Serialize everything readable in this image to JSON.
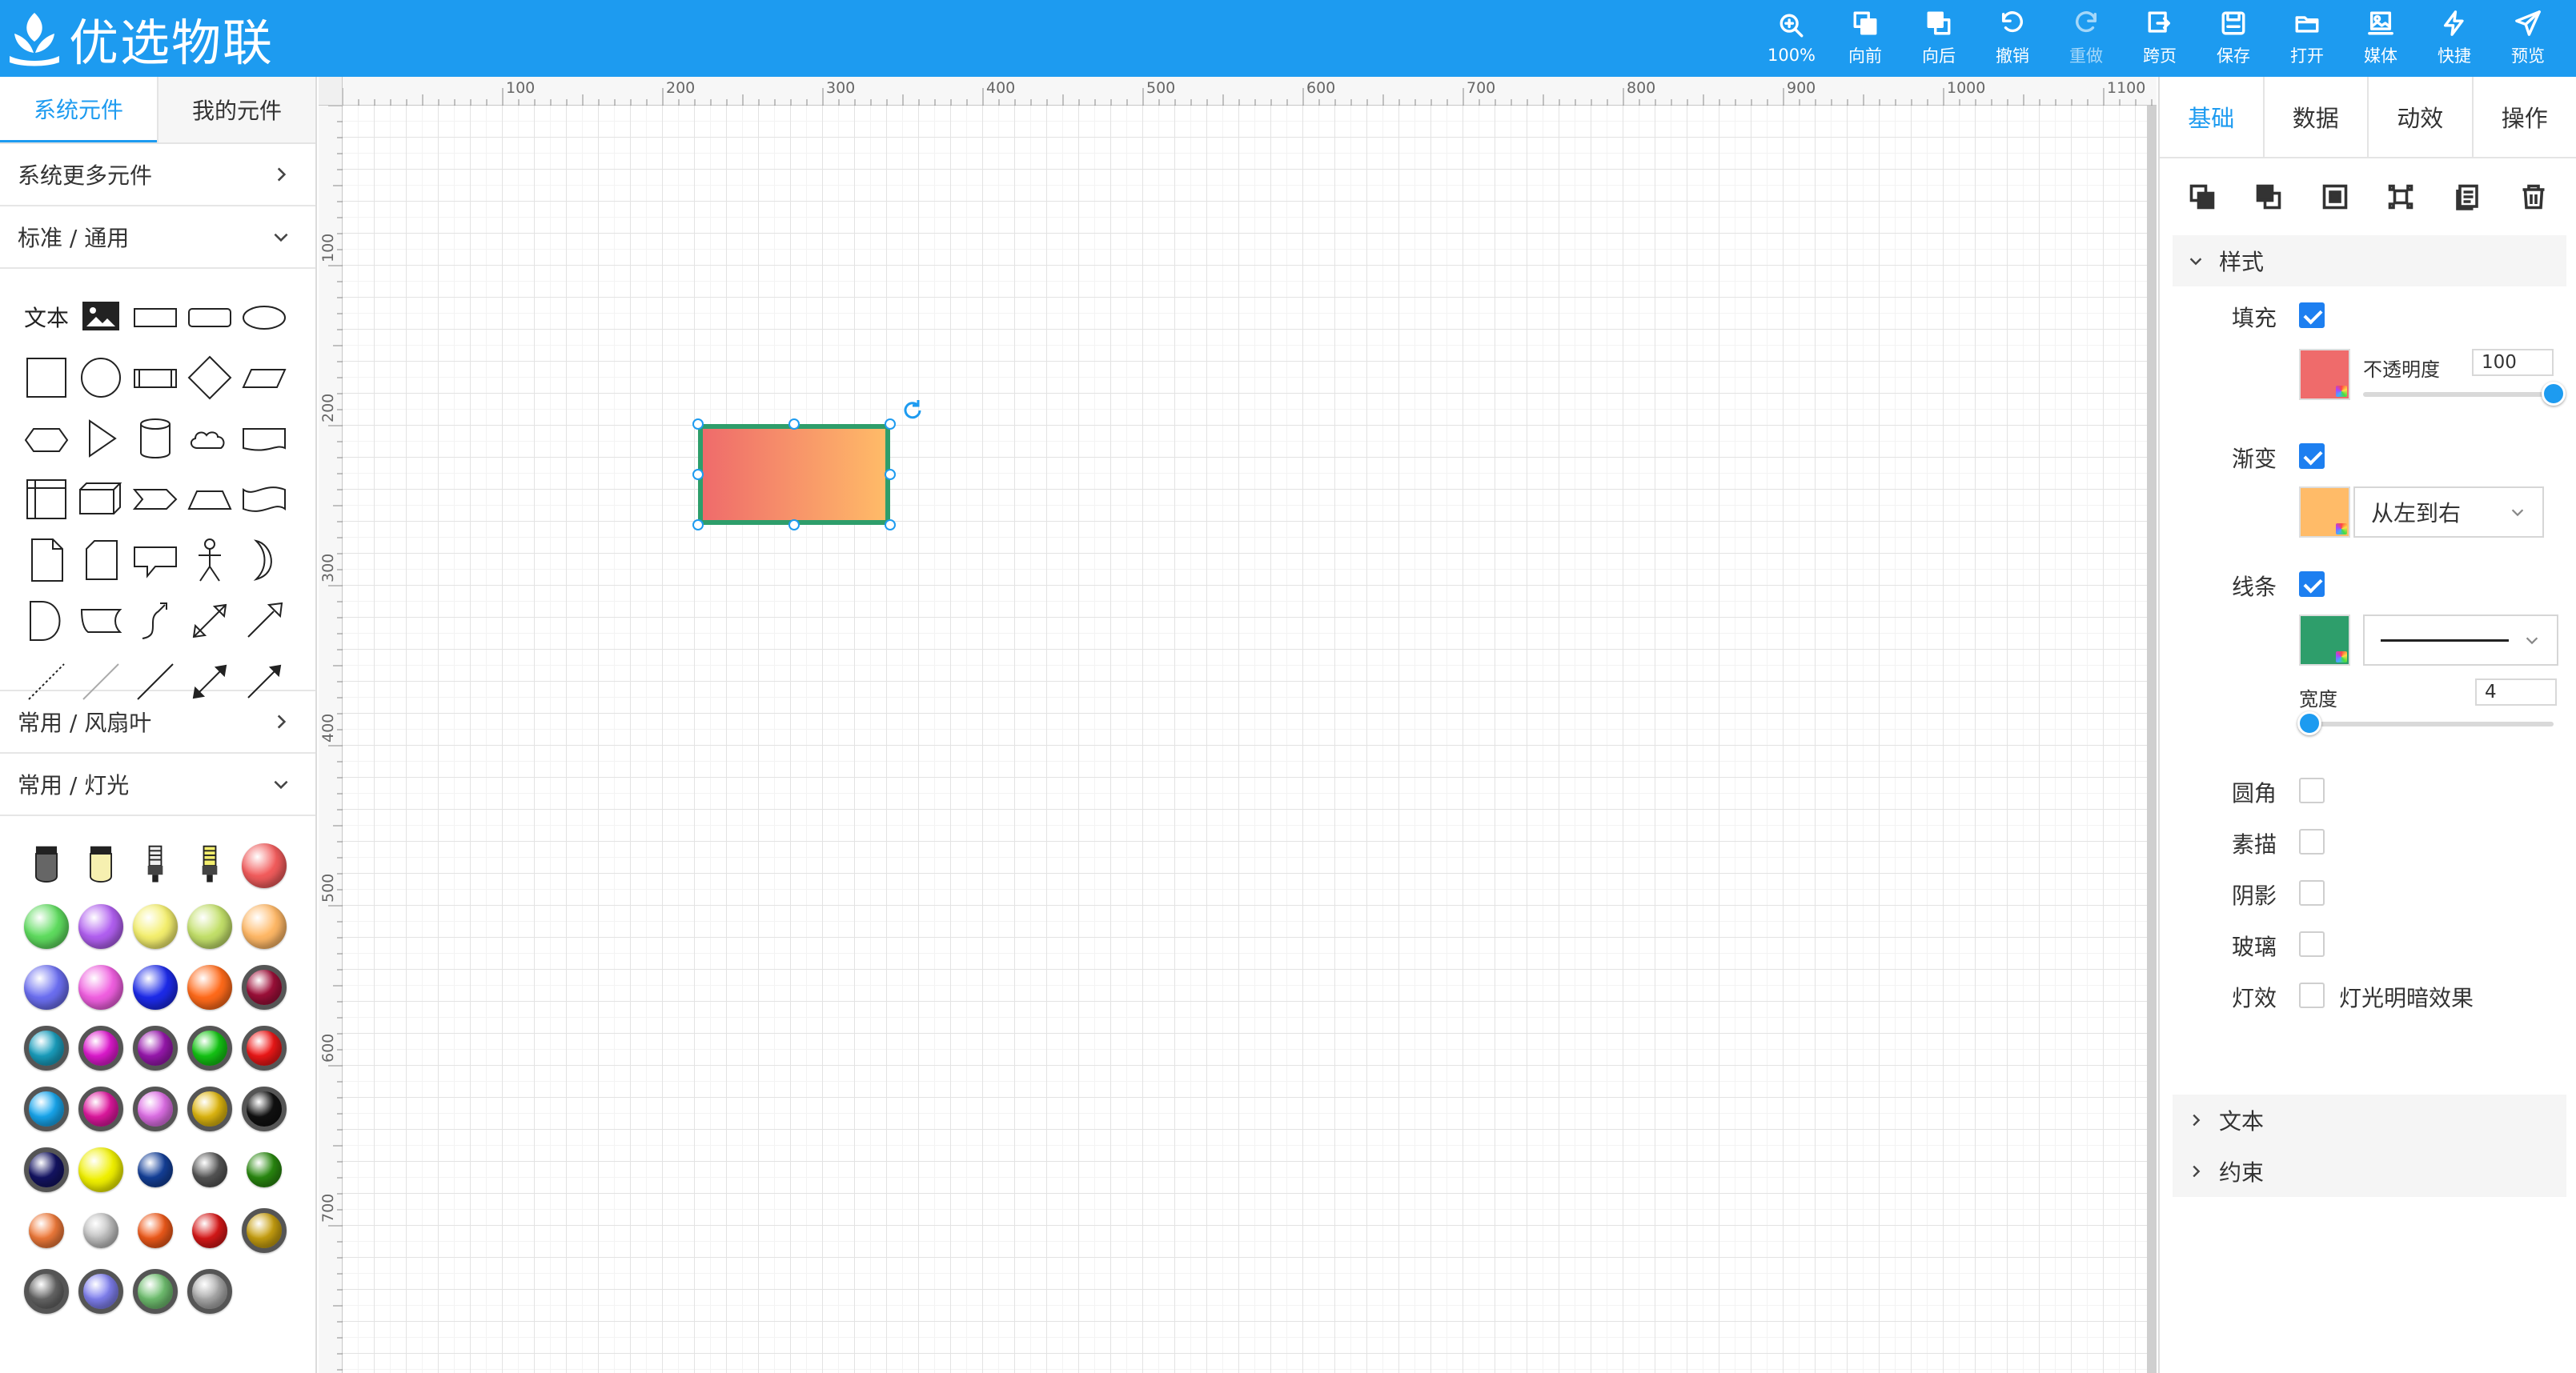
{
  "app": {
    "brand": "优选物联"
  },
  "toolbar": {
    "zoom": "100%",
    "forward": "向前",
    "backward": "向后",
    "undo": "撤销",
    "redo": "重做",
    "cross_page": "跨页",
    "save": "保存",
    "open": "打开",
    "media": "媒体",
    "quick": "快捷",
    "preview": "预览"
  },
  "left": {
    "tabs": [
      "系统元件",
      "我的元件"
    ],
    "more": "系统更多元件",
    "sections": [
      "标准 / 通用",
      "常用 / 风扇叶",
      "常用 / 灯光"
    ],
    "text_shape": "文本",
    "shape_icons": [
      "text",
      "image",
      "rectangle",
      "rounded-rectangle",
      "ellipse",
      "square",
      "circle",
      "process",
      "diamond",
      "parallelogram",
      "hexagon",
      "triangle",
      "cylinder",
      "cloud",
      "document",
      "internal-storage",
      "cube",
      "step",
      "trapezoid",
      "tape",
      "note",
      "card",
      "callout",
      "actor",
      "crescent",
      "delay",
      "loop-limit",
      "curve",
      "bidirectional-arrow",
      "arrow",
      "dashed-line",
      "thin-line",
      "line",
      "double-arrow-line",
      "arrow-line"
    ],
    "light_colors": [
      "#f25c5c",
      "#5fdc5f",
      "#b15ff0",
      "#f4ef6e",
      "#c3e06a",
      "#ffb866",
      "#6b6ef0",
      "#f05fe0",
      "#1c2ae8",
      "#ff6a1a",
      "#a0103a",
      "#1aa0c0",
      "#e01ad0",
      "#9a18b0",
      "#14c814",
      "#f01818",
      "#18a8f0",
      "#e018a0",
      "#e070e8",
      "#e0b810",
      "#111111",
      "#141464",
      "#f0f000",
      "#14409a",
      "#555555",
      "#2a8a10",
      "#f07a3a",
      "#c0c0c0",
      "#f05a1a",
      "#d81818",
      "#c8a010",
      "#666666",
      "#8080f0",
      "#70c070",
      "#aaaaaa"
    ]
  },
  "ruler": {
    "top_labels": [
      "100",
      "200",
      "300",
      "400",
      "500",
      "600",
      "700",
      "800",
      "900",
      "1000",
      "1100"
    ],
    "left_labels": [
      "100",
      "200",
      "300",
      "400",
      "500",
      "600",
      "700"
    ]
  },
  "right": {
    "tabs": [
      "基础",
      "数据",
      "动效",
      "操作"
    ],
    "action_icons": [
      "bring-forward-icon",
      "send-backward-icon",
      "group-icon",
      "ungroup-icon",
      "copy-icon",
      "delete-icon"
    ],
    "style_section": "样式",
    "fill": {
      "label": "填充",
      "checked": true,
      "color": "#ef6b6b",
      "opacity_label": "不透明度",
      "opacity": "100",
      "opacity_level": 1.0
    },
    "gradient": {
      "label": "渐变",
      "checked": true,
      "color": "#ffbb68",
      "direction": "从左到右"
    },
    "stroke": {
      "label": "线条",
      "checked": true,
      "color": "#2e9e6b",
      "width_label": "宽度",
      "width": "4",
      "width_level": 0.04
    },
    "options": [
      {
        "label": "圆角",
        "checked": false
      },
      {
        "label": "素描",
        "checked": false
      },
      {
        "label": "阴影",
        "checked": false
      },
      {
        "label": "玻璃",
        "checked": false
      },
      {
        "label": "灯效",
        "checked": false,
        "note": "灯光明暗效果"
      }
    ],
    "text_section": "文本",
    "constraint_section": "约束"
  }
}
